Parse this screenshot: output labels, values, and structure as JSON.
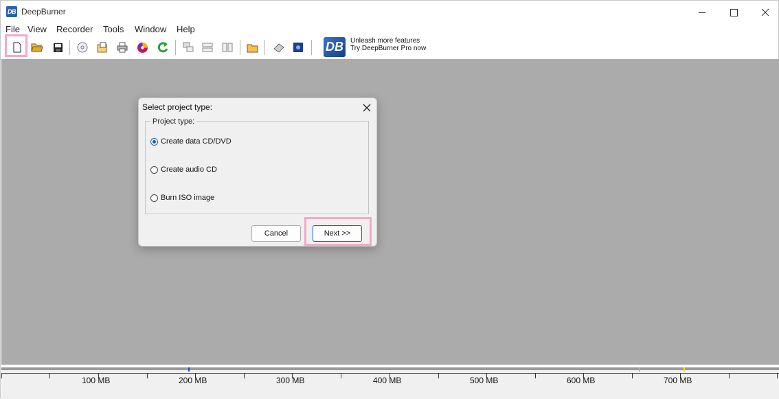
{
  "window": {
    "title": "DeepBurner",
    "app_icon_text": "DB"
  },
  "menu": [
    "File",
    "View",
    "Recorder",
    "Tools",
    "Window",
    "Help"
  ],
  "promo": {
    "logo_text": "DB",
    "line1": "Unleash more features",
    "line2": "Try DeepBurner Pro now"
  },
  "dialog": {
    "title": "Select project type:",
    "group_label": "Project type:",
    "options": [
      "Create data CD/DVD",
      "Create audio CD",
      "Burn ISO image"
    ],
    "selected_index": 0,
    "cancel_label": "Cancel",
    "next_label": "Next >>"
  },
  "ruler": {
    "labels": [
      "100 MB",
      "200 MB",
      "300 MB",
      "400 MB",
      "500 MB",
      "600 MB",
      "700 MB"
    ]
  }
}
